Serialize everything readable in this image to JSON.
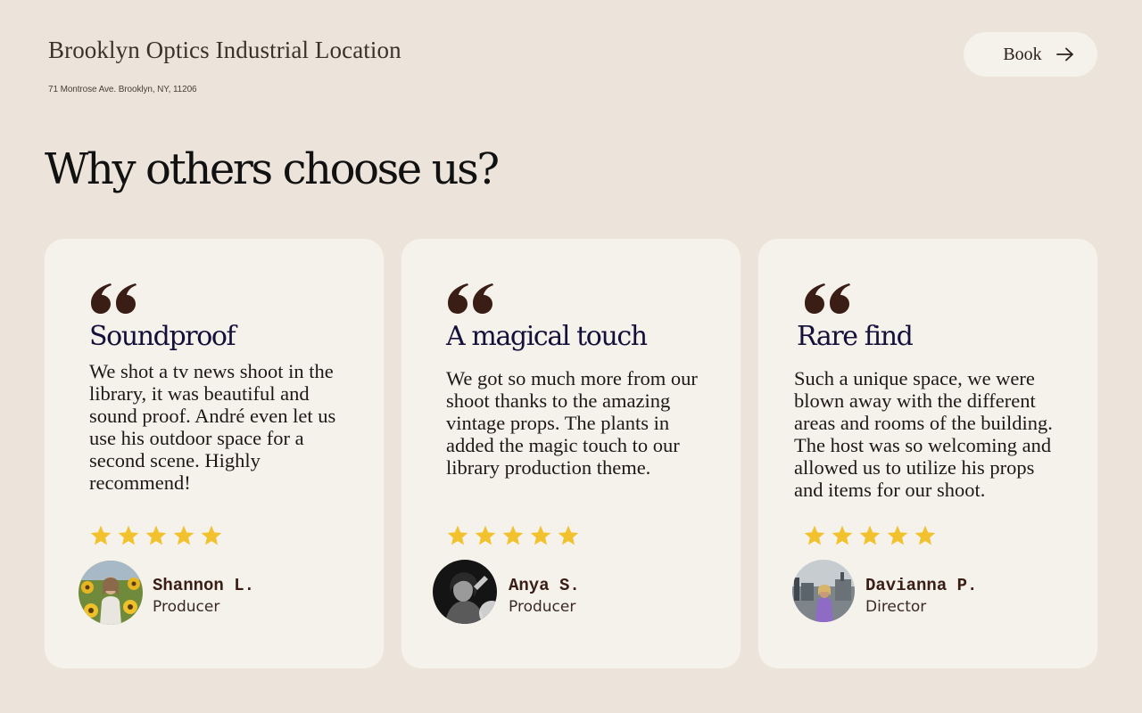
{
  "header": {
    "title": "Brooklyn Optics Industrial Location",
    "address": "71 Montrose Ave. Brooklyn, NY, 11206",
    "book_label": "Book",
    "book_icon": "arrow-right-icon"
  },
  "section": {
    "title": "Why others choose us?"
  },
  "colors": {
    "background": "#ece4da",
    "card": "#f5f2ec",
    "quote_mark": "#3a1e16",
    "star": "#f2c12e",
    "heading": "#15103a"
  },
  "testimonials": [
    {
      "title": "Soundproof",
      "body": "We shot a tv news shoot in the library, it was beautiful and sound proof. André even let us use his outdoor space for a second scene. Highly recommend!",
      "rating": 5,
      "name": "Shannon L.",
      "role": "Producer"
    },
    {
      "title": "A magical touch",
      "body": "We got so much more from our shoot thanks to the amazing vintage props. The plants in added the magic touch to our library production theme.",
      "rating": 5,
      "name": "Anya S.",
      "role": "Producer"
    },
    {
      "title": "Rare find",
      "body": "Such a unique space, we were blown away with the different areas and rooms of the building. The host was so welcoming and allowed us to utilize his props and items for our shoot.",
      "rating": 5,
      "name": "Davianna P.",
      "role": "Director"
    }
  ]
}
